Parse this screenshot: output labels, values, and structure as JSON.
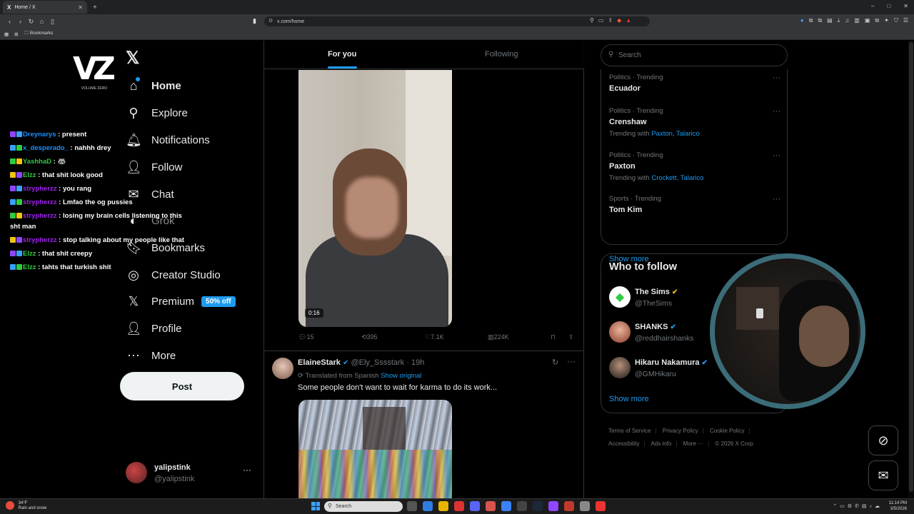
{
  "browser": {
    "tab_title": "Home / X",
    "tab_favicon": "X",
    "new_tab": "+",
    "url": "x.com/home",
    "bookmarks_label": "Bookmarks",
    "win_controls": [
      "–",
      "□",
      "✕"
    ]
  },
  "channel_logo": {
    "mark": "VZ",
    "sub": "VOLUME ZERO"
  },
  "nav": {
    "logo": "𝕏",
    "items": [
      {
        "label": "Home",
        "icon": "home-icon",
        "glyph": "⌂"
      },
      {
        "label": "Explore",
        "icon": "search-icon",
        "glyph": "⚲"
      },
      {
        "label": "Notifications",
        "icon": "bell-icon",
        "glyph": "🔔︎"
      },
      {
        "label": "Follow",
        "icon": "add-person-icon",
        "glyph": "👤︎"
      },
      {
        "label": "Chat",
        "icon": "mail-icon",
        "glyph": "✉"
      },
      {
        "label": "Grok",
        "icon": "grok-icon",
        "glyph": "◐"
      },
      {
        "label": "Bookmarks",
        "icon": "bookmark-icon",
        "glyph": "🔖︎"
      },
      {
        "label": "Creator Studio",
        "icon": "studio-icon",
        "glyph": "◎"
      },
      {
        "label": "Premium",
        "icon": "x-icon",
        "glyph": "𝕏",
        "badge": "50% off"
      },
      {
        "label": "Profile",
        "icon": "person-icon",
        "glyph": "👤︎"
      },
      {
        "label": "More",
        "icon": "more-circle-icon",
        "glyph": "⋯"
      }
    ],
    "post_button": "Post",
    "profile": {
      "name": "yalipstink",
      "handle": "@yalipstink",
      "more": "···"
    }
  },
  "chat": [
    {
      "user": "Dreynarys",
      "color": "u1",
      "msg": " : present"
    },
    {
      "user": "x_desperado_",
      "color": "u1",
      "msg": " : nahhh drey"
    },
    {
      "user": "YashhaD",
      "color": "u2",
      "msg": " : 🦝"
    },
    {
      "user": "Elzz",
      "color": "u2",
      "msg": " : that shit look good"
    },
    {
      "user": "strypherzz",
      "color": "u3",
      "msg": " : you rang"
    },
    {
      "user": "strypherzz",
      "color": "u3",
      "msg": " : Lmfao the og pussies"
    },
    {
      "user": "strypherzz",
      "color": "u3",
      "msg": " : losing my brain cells listening to this sht man"
    },
    {
      "user": "strypherzz",
      "color": "u3",
      "msg": " : stop talking about my people like that"
    },
    {
      "user": "Elzz",
      "color": "u2",
      "msg": " : that shit creepy"
    },
    {
      "user": "Elzz",
      "color": "u2",
      "msg": " : tahts that turkish shit"
    }
  ],
  "feed": {
    "tabs": [
      "For you",
      "Following"
    ],
    "video_time": "0:16",
    "actions": {
      "replies": "15",
      "reposts": "395",
      "likes": "7.1K",
      "views": "224K"
    },
    "tweet2": {
      "name": "ElaineStark",
      "handle": "@Ely_Sssstark",
      "time": "19h",
      "translated": "Translated from Spanish",
      "show_original": "Show original",
      "text": "Some people don't want to wait for karma to do its work..."
    }
  },
  "right": {
    "search_placeholder": "Search",
    "trends": [
      {
        "cat": "Politics · Trending",
        "name": "Ecuador",
        "with": "",
        "links": ""
      },
      {
        "cat": "Politics · Trending",
        "name": "Crenshaw",
        "with": "Trending with ",
        "links": "Paxton, Talarico"
      },
      {
        "cat": "Politics · Trending",
        "name": "Paxton",
        "with": "Trending with ",
        "links": "Crockett, Talarico"
      },
      {
        "cat": "Sports · Trending",
        "name": "Tom Kim",
        "with": "",
        "links": ""
      }
    ],
    "show_more": "Show more",
    "who_to_follow": {
      "title": "Who to follow",
      "accounts": [
        {
          "name": "The Sims",
          "handle": "@TheSims",
          "badge": "gold"
        },
        {
          "name": "SHANKS",
          "handle": "@reddhairshanks",
          "badge": "blue"
        },
        {
          "name": "Hikaru Nakamura",
          "handle": "@GMHikaru",
          "badge": "blue"
        }
      ],
      "show_more": "Show more"
    },
    "footer": [
      "Terms of Service",
      "Privacy Policy",
      "Cookie Policy",
      "Accessibility",
      "Ads info",
      "More ···",
      "© 2026 X Corp."
    ]
  },
  "taskbar": {
    "weather_temp": "34°F",
    "weather_desc": "Rain and snow",
    "search": "Search",
    "time": "11:14 PM",
    "date": "3/5/2026"
  }
}
